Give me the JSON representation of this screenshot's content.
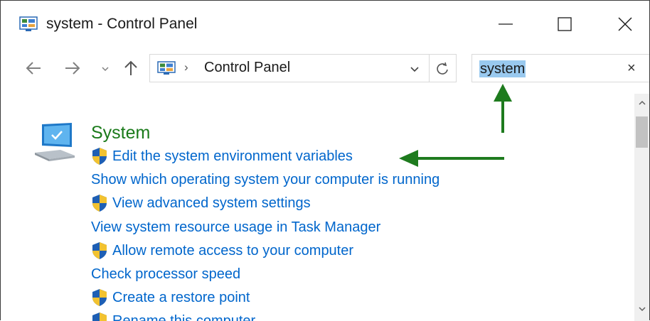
{
  "window": {
    "title": "system - Control Panel",
    "minimize_icon": "minimize-icon",
    "maximize_icon": "maximize-icon",
    "close_icon": "close-icon"
  },
  "nav": {
    "back_icon": "arrow-left-icon",
    "forward_icon": "arrow-right-icon",
    "recent_icon": "chevron-down-icon",
    "up_icon": "arrow-up-icon"
  },
  "address": {
    "separator": "›",
    "location": "Control Panel"
  },
  "search": {
    "value": "system",
    "clear": "×"
  },
  "section": {
    "title": "System",
    "links": [
      {
        "label": "Edit the system environment variables",
        "shield": true
      },
      {
        "label": "Show which operating system your computer is running",
        "shield": false
      },
      {
        "label": "View advanced system settings",
        "shield": true
      },
      {
        "label": "View system resource usage in Task Manager",
        "shield": false
      },
      {
        "label": "Allow remote access to your computer",
        "shield": true
      },
      {
        "label": "Check processor speed",
        "shield": false
      },
      {
        "label": "Create a restore point",
        "shield": true
      },
      {
        "label": "Rename this computer",
        "shield": true
      }
    ]
  },
  "colors": {
    "link": "#0066cc",
    "title_green": "#1a7a1a",
    "arrow_green": "#1e7b1e",
    "search_highlight": "#99c9ef"
  }
}
